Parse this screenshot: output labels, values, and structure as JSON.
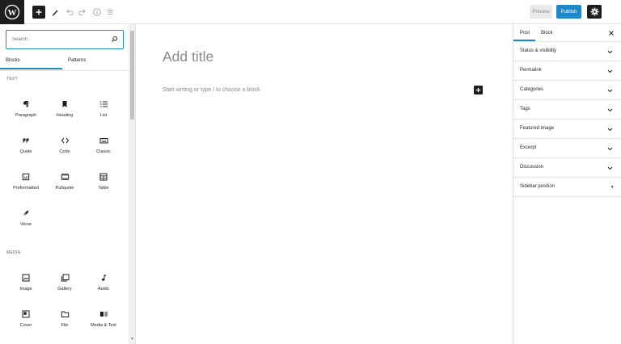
{
  "topbar": {
    "logo_icon": "wordpress-logo-icon",
    "toolbar_icons": [
      "plus-icon",
      "pen-tool-icon",
      "undo-icon",
      "redo-icon",
      "info-icon",
      "list-view-icon"
    ],
    "preview_label": "Preview",
    "publish_label": "Publish",
    "settings_icon": "gear-icon",
    "accent_color": "#1e88c8"
  },
  "inserter": {
    "search_placeholder": "Search",
    "tabs": [
      {
        "label": "Blocks",
        "active": true
      },
      {
        "label": "Patterns",
        "active": false
      }
    ],
    "sections": [
      {
        "label": "TEXT",
        "blocks": [
          {
            "label": "Paragraph",
            "icon": "paragraph-icon"
          },
          {
            "label": "Heading",
            "icon": "bookmark-icon"
          },
          {
            "label": "List",
            "icon": "list-icon"
          },
          {
            "label": "Quote",
            "icon": "quote-icon"
          },
          {
            "label": "Code",
            "icon": "code-icon"
          },
          {
            "label": "Classic",
            "icon": "keyboard-icon"
          },
          {
            "label": "Preformatted",
            "icon": "preformatted-icon"
          },
          {
            "label": "Pullquote",
            "icon": "pullquote-icon"
          },
          {
            "label": "Table",
            "icon": "table-icon"
          },
          {
            "label": "Verse",
            "icon": "feather-icon"
          }
        ]
      },
      {
        "label": "MEDIA",
        "blocks": [
          {
            "label": "Image",
            "icon": "image-icon"
          },
          {
            "label": "Gallery",
            "icon": "gallery-icon"
          },
          {
            "label": "Audio",
            "icon": "music-note-icon"
          },
          {
            "label": "Cover",
            "icon": "cover-icon"
          },
          {
            "label": "File",
            "icon": "folder-icon"
          },
          {
            "label": "Media & Text",
            "icon": "media-text-icon"
          }
        ]
      }
    ]
  },
  "editor": {
    "title_placeholder": "Add title",
    "block_placeholder": "Start writing or type / to choose a block"
  },
  "sidebar": {
    "tabs": [
      {
        "label": "Post",
        "active": true
      },
      {
        "label": "Block",
        "active": false
      }
    ],
    "panels": [
      {
        "label": "Status & visibility"
      },
      {
        "label": "Permalink"
      },
      {
        "label": "Categories"
      },
      {
        "label": "Tags"
      },
      {
        "label": "Featured image"
      },
      {
        "label": "Excerpt"
      },
      {
        "label": "Discussion"
      },
      {
        "label": "Sidebar position"
      }
    ]
  }
}
